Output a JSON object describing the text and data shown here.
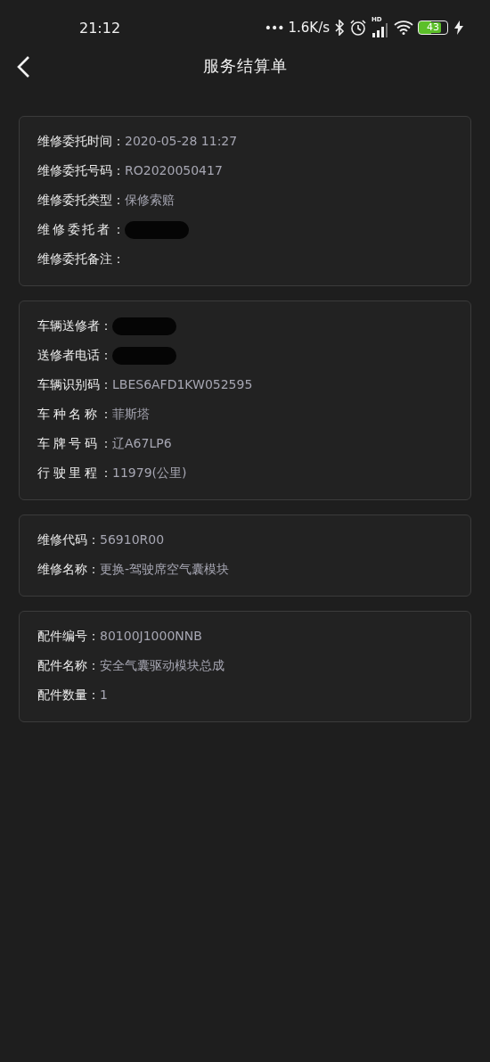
{
  "status_bar": {
    "time": "21:12",
    "dots": "•••",
    "net_speed": "1.6K/s",
    "signal_tag": "HD",
    "battery": "43"
  },
  "header": {
    "title": "服务结算单"
  },
  "cards": [
    {
      "rows": [
        {
          "label": "维修委托时间：",
          "value": "2020-05-28 11:27"
        },
        {
          "label": "维修委托号码：",
          "value": "RO2020050417"
        },
        {
          "label": "维修委托类型：",
          "value": "保修索赔"
        },
        {
          "label": "维修委托者：",
          "redacted": true
        },
        {
          "label": "维修委托备注："
        }
      ]
    },
    {
      "rows": [
        {
          "label": "车辆送修者：",
          "redacted": true
        },
        {
          "label": "送修者电话：",
          "redacted": true
        },
        {
          "label": "车辆识别码：",
          "value": "LBES6AFD1KW052595"
        },
        {
          "label": "车种名称：",
          "value": "菲斯塔"
        },
        {
          "label": "车牌号码：",
          "value": "辽A67LP6"
        },
        {
          "label": "行驶里程：",
          "value": "11979(公里)"
        }
      ]
    },
    {
      "rows": [
        {
          "label": "维修代码：",
          "value": "56910R00"
        },
        {
          "label": "维修名称：",
          "value": "更换-驾驶席空气囊模块"
        }
      ]
    },
    {
      "rows": [
        {
          "label": "配件编号：",
          "value": "80100J1000NNB"
        },
        {
          "label": "配件名称：",
          "value": "安全气囊驱动模块总成"
        },
        {
          "label": "配件数量：",
          "value": "1"
        }
      ]
    }
  ]
}
